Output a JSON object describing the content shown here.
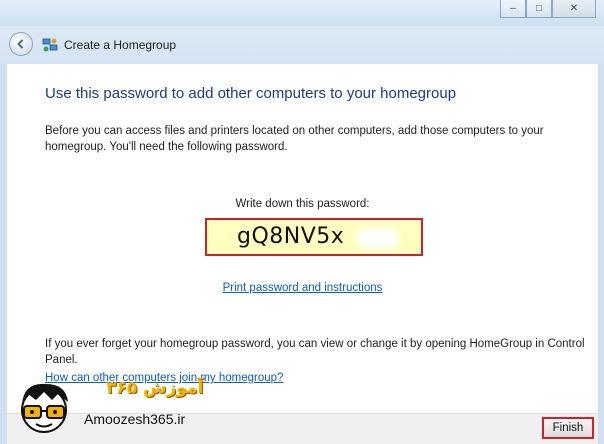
{
  "window": {
    "title": "Create a Homegroup",
    "controls": {
      "minimize": "–",
      "maximize": "□",
      "close": "✕"
    }
  },
  "main": {
    "heading": "Use this password to add other computers to your homegroup",
    "intro": "Before you can access files and printers located on other computers, add those computers to your homegroup. You'll need the following password.",
    "password_label": "Write down this password:",
    "password": "gQ8NV5x",
    "print_link": "Print password and instructions",
    "note": "If you ever forget your homegroup password, you can view or change it by opening HomeGroup in Control Panel.",
    "help_link": "How can other computers join my homegroup?"
  },
  "footer": {
    "finish_label": "Finish"
  },
  "watermark": {
    "brand": "Amoozesh365.ir",
    "persian": "آموزش ۳۶۵"
  },
  "colors": {
    "highlight_border": "#d0212b",
    "password_bg": "#fffec0",
    "link": "#0b5bd1",
    "heading": "#1e3a8a"
  }
}
